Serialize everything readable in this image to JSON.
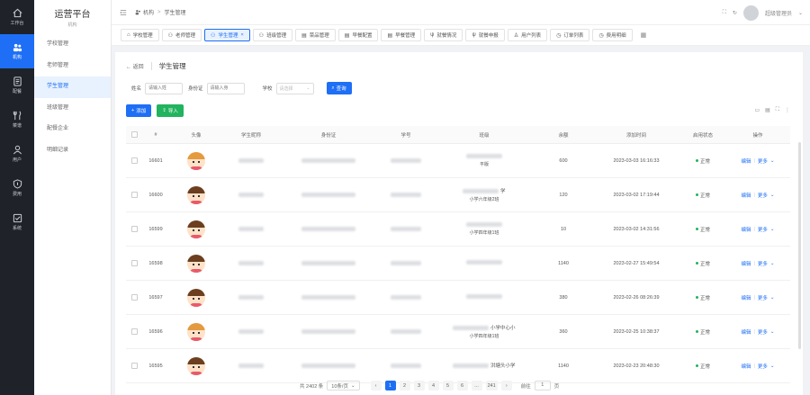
{
  "rail": [
    {
      "icon": "home-icon",
      "label": "工作台",
      "active": false
    },
    {
      "icon": "org-icon",
      "label": "机构",
      "active": true
    },
    {
      "icon": "document-icon",
      "label": "配餐",
      "active": false
    },
    {
      "icon": "dining-icon",
      "label": "菜谱",
      "active": false
    },
    {
      "icon": "user-icon",
      "label": "用户",
      "active": false
    },
    {
      "icon": "shield-icon",
      "label": "费用",
      "active": false
    },
    {
      "icon": "system-icon",
      "label": "系统",
      "active": false
    }
  ],
  "menu": {
    "title": "运营平台",
    "subtitle": "机构",
    "items": [
      "学校管理",
      "老师管理",
      "学生管理",
      "班级管理",
      "配餐企业",
      "明细记录"
    ],
    "active_index": 2
  },
  "header": {
    "crumb_root": "机构",
    "crumb_current": "学生管理",
    "user_name": "超级管理员"
  },
  "tabs": [
    {
      "label": "学校管理",
      "icon": "building-icon"
    },
    {
      "label": "老师管理",
      "icon": "user-group-icon"
    },
    {
      "label": "学生管理",
      "icon": "user-group-icon",
      "active": true
    },
    {
      "label": "班级管理",
      "icon": "class-icon"
    },
    {
      "label": "菜品管理",
      "icon": "dish-icon"
    },
    {
      "label": "早餐配置",
      "icon": "menu-icon"
    },
    {
      "label": "早餐管理",
      "icon": "menu-icon"
    },
    {
      "label": "就餐情况",
      "icon": "dining-icon"
    },
    {
      "label": "就餐申报",
      "icon": "dining-icon"
    },
    {
      "label": "用户列表",
      "icon": "user-icon"
    },
    {
      "label": "订单列表",
      "icon": "clock-icon"
    },
    {
      "label": "费用明细",
      "icon": "clock-icon"
    }
  ],
  "page": {
    "back_label": "返回",
    "title": "学生管理"
  },
  "filters": {
    "name_label": "姓名",
    "name_placeholder": "请输入姓",
    "idcard_label": "身份证",
    "idcard_placeholder": "请输入身",
    "school_label": "学校",
    "school_placeholder": "请选择",
    "search_label": "查询"
  },
  "actions": {
    "add_label": "添加",
    "import_label": "导入"
  },
  "table": {
    "headers": [
      "#",
      "头像",
      "学生昵称",
      "身份证",
      "学号",
      "班级",
      "余额",
      "添加时间",
      "启用状态",
      "操作"
    ],
    "rows": [
      {
        "id": "16601",
        "avatar": "girl",
        "cls_suffix": "",
        "cls_sub": "平版",
        "balance": "600",
        "time": "2023-03-03 16:16:33",
        "status": "正常"
      },
      {
        "id": "16600",
        "avatar": "boy",
        "cls_suffix": "学",
        "cls_sub": "小学六年级2班",
        "balance": "120",
        "time": "2023-03-02 17:19:44",
        "status": "正常"
      },
      {
        "id": "16599",
        "avatar": "boy",
        "cls_suffix": "",
        "cls_sub": "小学四年级1班",
        "balance": "10",
        "time": "2023-03-02 14:31:56",
        "status": "正常"
      },
      {
        "id": "16598",
        "avatar": "boy",
        "cls_suffix": "",
        "cls_sub": "",
        "balance": "1140",
        "time": "2023-02-27 15:49:54",
        "status": "正常"
      },
      {
        "id": "16597",
        "avatar": "boy",
        "cls_suffix": "",
        "cls_sub": "",
        "balance": "380",
        "time": "2023-02-26 08:26:39",
        "status": "正常"
      },
      {
        "id": "16596",
        "avatar": "girl",
        "cls_suffix": "小学中心小",
        "cls_sub": "小学四年级1班",
        "balance": "360",
        "time": "2023-02-25 10:38:37",
        "status": "正常"
      },
      {
        "id": "16595",
        "avatar": "boy",
        "cls_suffix": "洪塘头小学",
        "cls_sub": "",
        "balance": "1140",
        "time": "2023-02-23 20:48:30",
        "status": "正常"
      }
    ],
    "edit_label": "编辑",
    "more_label": "更多"
  },
  "pager": {
    "total": "共 2402 条",
    "size": "10条/页",
    "pages": [
      "1",
      "2",
      "3",
      "4",
      "5",
      "6",
      "...",
      "241"
    ],
    "goto_label": "前往",
    "goto_value": "1",
    "page_unit": "页"
  },
  "colors": {
    "primary": "#1e6ff5",
    "success": "#22b35e",
    "rail": "#1f2329"
  }
}
